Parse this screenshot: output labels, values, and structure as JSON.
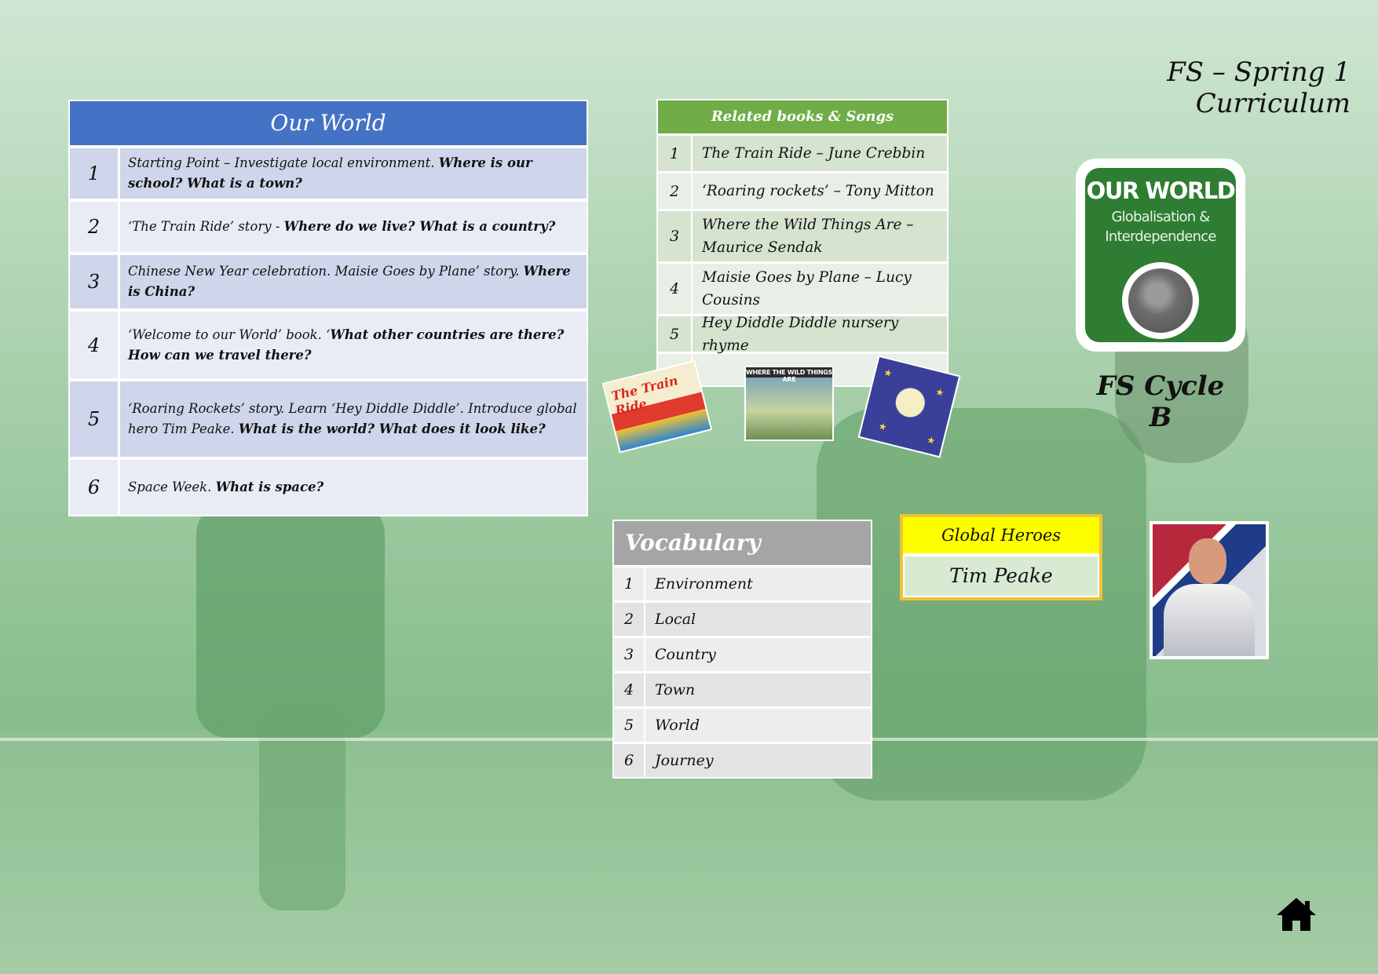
{
  "page": {
    "title": "FS – Spring 1 Curriculum",
    "cycle": "FS Cycle B"
  },
  "our_world": {
    "title": "Our World",
    "rows": [
      {
        "num": "1",
        "plain": "Starting Point – Investigate local environment. ",
        "bold": "Where is our school? What is a town?"
      },
      {
        "num": "2",
        "plain": "‘The Train Ride’ story - ",
        "bold": "Where do we live? What is a country?"
      },
      {
        "num": "3",
        "plain": "Chinese New Year celebration. Maisie Goes by Plane’ story. ",
        "bold": "Where is China?"
      },
      {
        "num": "4",
        "plain": "‘Welcome to our World’ book. ‘",
        "bold": "What other countries are there? How can we travel there?"
      },
      {
        "num": "5",
        "plain": "‘Roaring Rockets’ story. Learn ‘Hey Diddle Diddle’. Introduce global hero Tim Peake. ",
        "bold": "What is the world? What does it look like?"
      },
      {
        "num": "6",
        "plain": "Space Week. ",
        "bold": "What is space?"
      }
    ]
  },
  "books": {
    "title": "Related books & Songs",
    "rows": [
      {
        "num": "1",
        "text": "The Train Ride – June Crebbin"
      },
      {
        "num": "2",
        "text": "‘Roaring rockets’ – Tony Mitton"
      },
      {
        "num": "3",
        "text": "Where the Wild Things Are – Maurice Sendak"
      },
      {
        "num": "4",
        "text": "Maisie Goes by Plane – Lucy Cousins"
      },
      {
        "num": "5",
        "text": "Hey Diddle Diddle nursery rhyme"
      }
    ],
    "covers": {
      "train": "The Train Ride",
      "wild": "WHERE THE WILD THINGS ARE"
    }
  },
  "logo": {
    "title": "OUR WORLD",
    "subtitle": "Globalisation & Interdependence",
    "color": "#2e7d32"
  },
  "vocabulary": {
    "title": "Vocabulary",
    "rows": [
      {
        "num": "1",
        "word": "Environment"
      },
      {
        "num": "2",
        "word": "Local"
      },
      {
        "num": "3",
        "word": "Country"
      },
      {
        "num": "4",
        "word": "Town"
      },
      {
        "num": "5",
        "word": "World"
      },
      {
        "num": "6",
        "word": "Journey"
      }
    ]
  },
  "heroes": {
    "title": "Global Heroes",
    "name": "Tim Peake"
  },
  "icons": {
    "home": "home-icon"
  },
  "colors": {
    "our_world_header": "#4472c4",
    "books_header": "#70ad47",
    "vocab_header": "#a5a5a5",
    "heroes_header": "#ffff00"
  }
}
